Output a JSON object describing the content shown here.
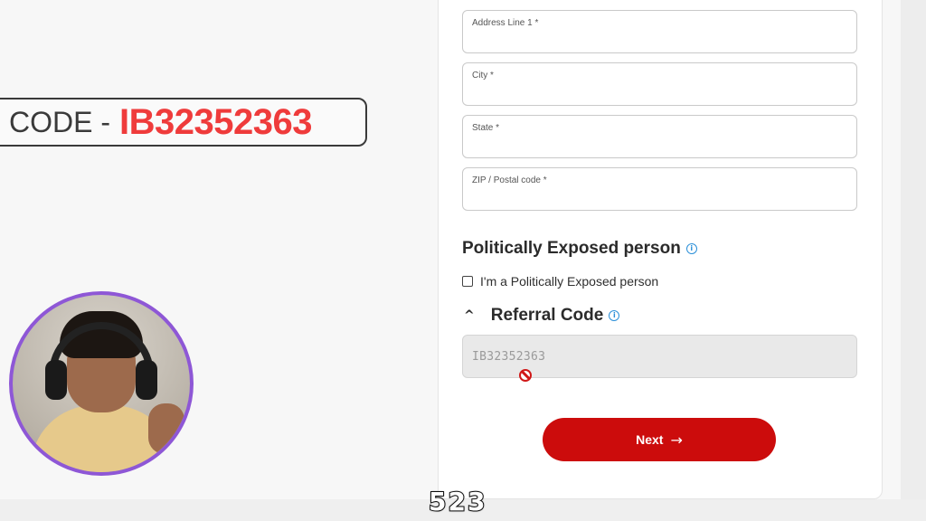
{
  "banner": {
    "label": "CODE -",
    "code": "IB32352363"
  },
  "form": {
    "address": {
      "label": "Address Line 1 *",
      "value": ""
    },
    "city": {
      "label": "City *",
      "value": ""
    },
    "state": {
      "label": "State *",
      "value": ""
    },
    "zip": {
      "label": "ZIP / Postal code *",
      "value": ""
    },
    "pep": {
      "title": "Politically Exposed person",
      "checkbox_label": "I'm a Politically Exposed person",
      "checked": false
    },
    "referral": {
      "title": "Referral Code",
      "expanded": true,
      "value": "IB32352363",
      "disabled": true
    },
    "next_label": "Next"
  },
  "counter": "523",
  "icons": {
    "info": "info-icon",
    "chevron": "chevron-up-icon",
    "arrow": "arrow-right-icon",
    "cursor": "not-allowed-cursor-icon"
  },
  "colors": {
    "accent": "#cc0c0c",
    "code_highlight": "#ef3b3b",
    "info": "#2a8fd8",
    "avatar_ring": "#8e57d6"
  }
}
